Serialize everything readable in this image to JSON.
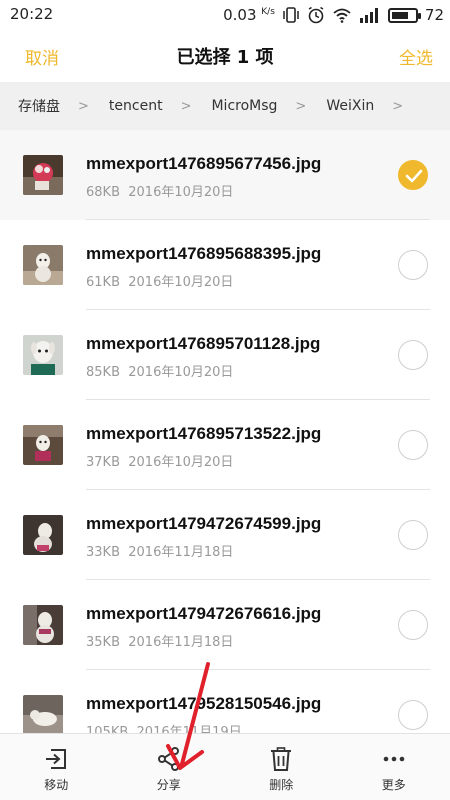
{
  "status_bar": {
    "time": "20:22",
    "speed_value": "0.03",
    "speed_unit": "K/s",
    "battery": "72",
    "icons": [
      "vibrate-icon",
      "alarm-icon",
      "wifi-icon",
      "signal-icon",
      "battery-icon"
    ]
  },
  "action_bar": {
    "cancel_label": "取消",
    "title": "已选择 1 项",
    "select_all_label": "全选",
    "accent_color": "#f0b82c"
  },
  "breadcrumb": {
    "items": [
      "存储盘",
      "tencent",
      "MicroMsg",
      "WeiXin"
    ],
    "separator": ">"
  },
  "files": [
    {
      "name": "mmexport1476895677456.jpg",
      "size": "68KB",
      "date": "2016年10月20日",
      "selected": true
    },
    {
      "name": "mmexport1476895688395.jpg",
      "size": "61KB",
      "date": "2016年10月20日",
      "selected": false
    },
    {
      "name": "mmexport1476895701128.jpg",
      "size": "85KB",
      "date": "2016年10月20日",
      "selected": false
    },
    {
      "name": "mmexport1476895713522.jpg",
      "size": "37KB",
      "date": "2016年10月20日",
      "selected": false
    },
    {
      "name": "mmexport1479472674599.jpg",
      "size": "33KB",
      "date": "2016年11月18日",
      "selected": false
    },
    {
      "name": "mmexport1479472676616.jpg",
      "size": "35KB",
      "date": "2016年11月18日",
      "selected": false
    },
    {
      "name": "mmexport1479528150546.jpg",
      "size": "105KB",
      "date": "2016年11月19日",
      "selected": false
    }
  ],
  "bottom_bar": {
    "move_label": "移动",
    "share_label": "分享",
    "delete_label": "删除",
    "more_label": "更多"
  },
  "annotation_color": "#e0202a"
}
